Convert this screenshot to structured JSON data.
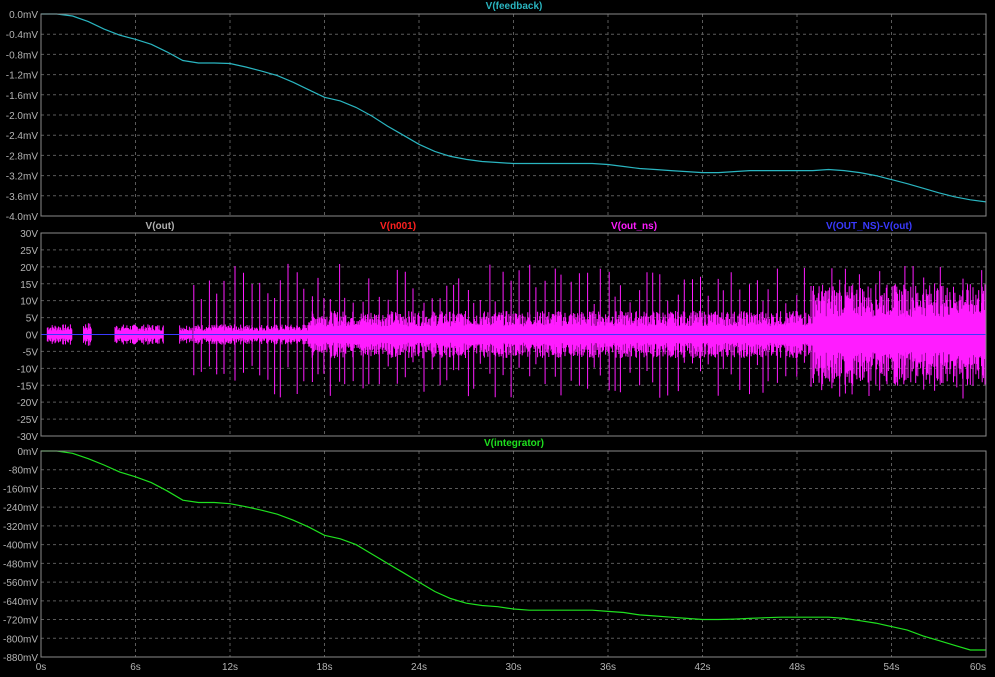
{
  "chart_data": [
    {
      "type": "line",
      "title": "",
      "x_ticks": [
        "0s",
        "6s",
        "12s",
        "18s",
        "24s",
        "30s",
        "36s",
        "42s",
        "48s",
        "54s",
        "60s"
      ],
      "xlim": [
        0,
        60
      ],
      "ylim": [
        -4.0,
        0.0
      ],
      "y_ticks": [
        "0.0mV",
        "-0.4mV",
        "-0.8mV",
        "-1.2mV",
        "-1.6mV",
        "-2.0mV",
        "-2.4mV",
        "-2.8mV",
        "-3.2mV",
        "-3.6mV",
        "-4.0mV"
      ],
      "grid": true,
      "series": [
        {
          "name": "V(feedback)",
          "color": "#2ab5c0",
          "x": [
            0,
            1,
            2,
            3,
            4,
            5,
            6,
            7,
            8,
            9,
            10,
            11,
            12,
            13,
            14,
            15,
            16,
            17,
            18,
            19,
            20,
            21,
            22,
            23,
            24,
            25,
            26,
            27,
            28,
            29,
            30,
            31,
            32,
            33,
            34,
            35,
            36,
            37,
            38,
            39,
            40,
            41,
            42,
            43,
            44,
            45,
            46,
            47,
            48,
            49,
            50,
            51,
            52,
            53,
            54,
            55,
            56,
            57,
            58,
            59,
            60
          ],
          "y": [
            0.0,
            0.0,
            -0.04,
            -0.15,
            -0.3,
            -0.42,
            -0.5,
            -0.6,
            -0.75,
            -0.92,
            -0.97,
            -0.97,
            -0.98,
            -1.05,
            -1.13,
            -1.22,
            -1.35,
            -1.5,
            -1.65,
            -1.72,
            -1.85,
            -2.02,
            -2.22,
            -2.4,
            -2.58,
            -2.72,
            -2.82,
            -2.88,
            -2.92,
            -2.94,
            -2.96,
            -2.96,
            -2.96,
            -2.96,
            -2.96,
            -2.96,
            -2.98,
            -3.02,
            -3.06,
            -3.08,
            -3.1,
            -3.12,
            -3.14,
            -3.14,
            -3.12,
            -3.1,
            -3.1,
            -3.1,
            -3.1,
            -3.1,
            -3.08,
            -3.1,
            -3.14,
            -3.2,
            -3.28,
            -3.36,
            -3.45,
            -3.54,
            -3.62,
            -3.68,
            -3.72
          ]
        }
      ]
    },
    {
      "type": "line",
      "title": "",
      "x_ticks": [
        "0s",
        "6s",
        "12s",
        "18s",
        "24s",
        "30s",
        "36s",
        "42s",
        "48s",
        "54s",
        "60s"
      ],
      "xlim": [
        0,
        60
      ],
      "ylim": [
        -30,
        30
      ],
      "y_ticks": [
        "30V",
        "25V",
        "20V",
        "15V",
        "10V",
        "5V",
        "0V",
        "-5V",
        "-10V",
        "-15V",
        "-20V",
        "-25V",
        "-30V"
      ],
      "grid": true,
      "series": [
        {
          "name": "V(out)",
          "color": "#b0b0b0"
        },
        {
          "name": "V(n001)",
          "color": "#ff2020"
        },
        {
          "name": "V(out_ns)",
          "color": "#ff1cff",
          "segments": [
            {
              "x0": 0.4,
              "x1": 2.0,
              "amp": 3
            },
            {
              "x0": 2.7,
              "x1": 3.2,
              "amp": 3.5
            },
            {
              "x0": 4.7,
              "x1": 7.8,
              "amp": 3
            },
            {
              "x0": 8.8,
              "x1": 9.6,
              "amp": 3
            },
            {
              "x0": 9.7,
              "x1": 17.0,
              "amp": 3
            },
            {
              "x0": 17.0,
              "x1": 49.0,
              "amp": 7
            },
            {
              "x0": 49.0,
              "x1": 60.0,
              "amp": 15
            }
          ],
          "spike_start": 9.7,
          "spike_peak": 20,
          "spike_low": -20
        },
        {
          "name": "V(OUT_NS)-V(out)",
          "color": "#3a3aff"
        }
      ]
    },
    {
      "type": "line",
      "title": "",
      "x_ticks": [
        "0s",
        "6s",
        "12s",
        "18s",
        "24s",
        "30s",
        "36s",
        "42s",
        "48s",
        "54s",
        "60s"
      ],
      "xlim": [
        0,
        60
      ],
      "ylim": [
        -880,
        0
      ],
      "y_ticks": [
        "0mV",
        "-80mV",
        "-160mV",
        "-240mV",
        "-320mV",
        "-400mV",
        "-480mV",
        "-560mV",
        "-640mV",
        "-720mV",
        "-800mV",
        "-880mV"
      ],
      "grid": true,
      "series": [
        {
          "name": "V(integrator)",
          "color": "#1fe01f",
          "x": [
            0,
            1,
            2,
            3,
            4,
            5,
            6,
            7,
            8,
            9,
            10,
            11,
            12,
            13,
            14,
            15,
            16,
            17,
            18,
            19,
            20,
            21,
            22,
            23,
            24,
            25,
            26,
            27,
            28,
            29,
            30,
            31,
            32,
            33,
            34,
            35,
            36,
            37,
            38,
            39,
            40,
            41,
            42,
            43,
            44,
            45,
            46,
            47,
            48,
            49,
            50,
            51,
            52,
            53,
            54,
            55,
            56,
            57,
            58,
            59,
            60
          ],
          "y": [
            0,
            0,
            -10,
            -33,
            -60,
            -90,
            -110,
            -135,
            -170,
            -210,
            -220,
            -220,
            -225,
            -238,
            -253,
            -270,
            -295,
            -325,
            -360,
            -375,
            -400,
            -440,
            -480,
            -520,
            -560,
            -600,
            -630,
            -650,
            -660,
            -665,
            -675,
            -680,
            -680,
            -680,
            -680,
            -680,
            -685,
            -690,
            -700,
            -705,
            -710,
            -715,
            -720,
            -720,
            -718,
            -715,
            -712,
            -710,
            -710,
            -710,
            -710,
            -715,
            -725,
            -735,
            -750,
            -765,
            -790,
            -810,
            -830,
            -850,
            -850
          ]
        }
      ]
    }
  ]
}
